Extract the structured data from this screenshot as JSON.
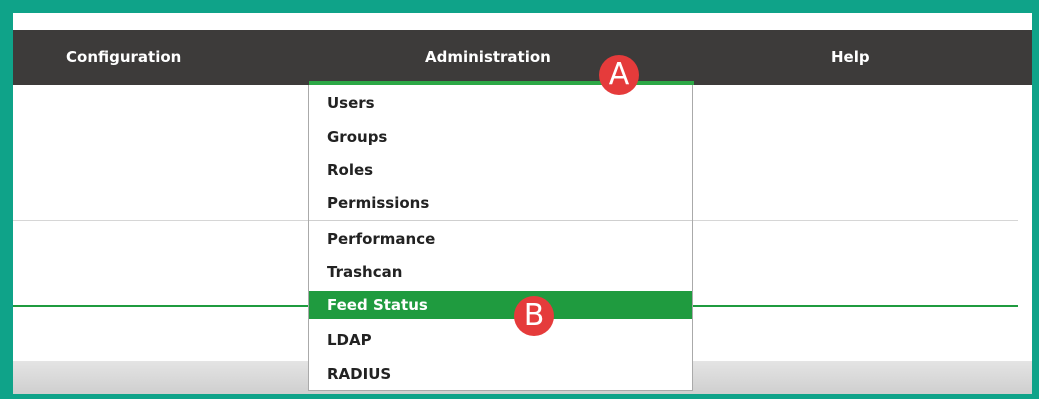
{
  "nav": {
    "items": [
      {
        "label": "Configuration"
      },
      {
        "label": "Administration"
      },
      {
        "label": "Help"
      }
    ],
    "active_index": 1
  },
  "dropdown": {
    "items": [
      {
        "label": "Users"
      },
      {
        "label": "Groups"
      },
      {
        "label": "Roles"
      },
      {
        "label": "Permissions"
      },
      {
        "label": "Performance"
      },
      {
        "label": "Trashcan"
      },
      {
        "label": "Feed Status",
        "selected": true
      },
      {
        "label": "LDAP"
      },
      {
        "label": "RADIUS"
      }
    ]
  },
  "annotations": {
    "a": "A",
    "b": "B"
  },
  "colors": {
    "frame": "#0fa389",
    "topbar": "#3d3b3a",
    "accent_green": "#1f9b3f",
    "badge_red": "#e53b3b"
  }
}
